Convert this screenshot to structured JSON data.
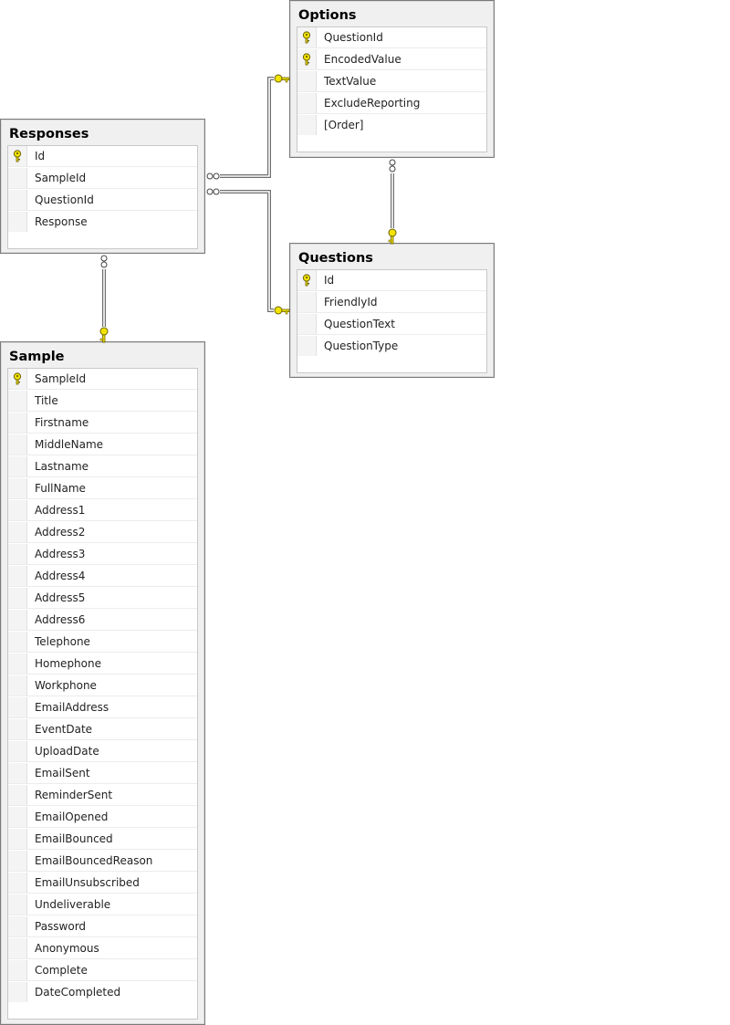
{
  "tables": {
    "options": {
      "title": "Options",
      "columns": [
        {
          "name": "QuestionId",
          "pk": true
        },
        {
          "name": "EncodedValue",
          "pk": true
        },
        {
          "name": "TextValue",
          "pk": false
        },
        {
          "name": "ExcludeReporting",
          "pk": false
        },
        {
          "name": "[Order]",
          "pk": false
        }
      ]
    },
    "responses": {
      "title": "Responses",
      "columns": [
        {
          "name": "Id",
          "pk": true
        },
        {
          "name": "SampleId",
          "pk": false
        },
        {
          "name": "QuestionId",
          "pk": false
        },
        {
          "name": "Response",
          "pk": false
        }
      ]
    },
    "questions": {
      "title": "Questions",
      "columns": [
        {
          "name": "Id",
          "pk": true
        },
        {
          "name": "FriendlyId",
          "pk": false
        },
        {
          "name": "QuestionText",
          "pk": false
        },
        {
          "name": "QuestionType",
          "pk": false
        }
      ]
    },
    "sample": {
      "title": "Sample",
      "columns": [
        {
          "name": "SampleId",
          "pk": true
        },
        {
          "name": "Title",
          "pk": false
        },
        {
          "name": "Firstname",
          "pk": false
        },
        {
          "name": "MiddleName",
          "pk": false
        },
        {
          "name": "Lastname",
          "pk": false
        },
        {
          "name": "FullName",
          "pk": false
        },
        {
          "name": "Address1",
          "pk": false
        },
        {
          "name": "Address2",
          "pk": false
        },
        {
          "name": "Address3",
          "pk": false
        },
        {
          "name": "Address4",
          "pk": false
        },
        {
          "name": "Address5",
          "pk": false
        },
        {
          "name": "Address6",
          "pk": false
        },
        {
          "name": "Telephone",
          "pk": false
        },
        {
          "name": "Homephone",
          "pk": false
        },
        {
          "name": "Workphone",
          "pk": false
        },
        {
          "name": "EmailAddress",
          "pk": false
        },
        {
          "name": "EventDate",
          "pk": false
        },
        {
          "name": "UploadDate",
          "pk": false
        },
        {
          "name": "EmailSent",
          "pk": false
        },
        {
          "name": "ReminderSent",
          "pk": false
        },
        {
          "name": "EmailOpened",
          "pk": false
        },
        {
          "name": "EmailBounced",
          "pk": false
        },
        {
          "name": "EmailBouncedReason",
          "pk": false
        },
        {
          "name": "EmailUnsubscribed",
          "pk": false
        },
        {
          "name": "Undeliverable",
          "pk": false
        },
        {
          "name": "Password",
          "pk": false
        },
        {
          "name": "Anonymous",
          "pk": false
        },
        {
          "name": "Complete",
          "pk": false
        },
        {
          "name": "DateCompleted",
          "pk": false
        }
      ]
    }
  },
  "relationships": [
    {
      "from": "responses",
      "to": "options",
      "many_end": "responses",
      "one_end": "options"
    },
    {
      "from": "responses",
      "to": "questions",
      "many_end": "responses",
      "one_end": "questions"
    },
    {
      "from": "options",
      "to": "questions",
      "many_end": "options",
      "one_end": "questions"
    },
    {
      "from": "responses",
      "to": "sample",
      "many_end": "responses",
      "one_end": "sample"
    }
  ],
  "colors": {
    "key": "#f2e400",
    "key_outline": "#6b6000",
    "connector": "#6e6e6e",
    "table_border": "#7a7a7a",
    "table_bg": "#f0f0f0"
  }
}
